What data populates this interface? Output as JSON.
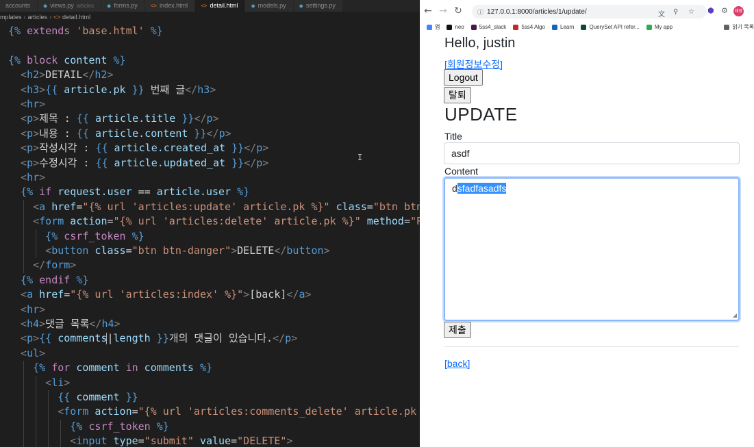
{
  "editor": {
    "tabs": [
      {
        "label": "accounts",
        "hint": "",
        "kind": "folder",
        "active": false
      },
      {
        "label": "views.py",
        "hint": "articles",
        "kind": "py",
        "active": false
      },
      {
        "label": "forms.py",
        "hint": "",
        "kind": "py",
        "active": false
      },
      {
        "label": "index.html",
        "hint": "",
        "kind": "html",
        "active": false
      },
      {
        "label": "detail.html",
        "hint": "",
        "kind": "html",
        "active": true
      },
      {
        "label": "models.py",
        "hint": "",
        "kind": "py",
        "active": false
      },
      {
        "label": "settings.py",
        "hint": "",
        "kind": "py",
        "active": false
      }
    ],
    "breadcrumb": [
      "mplates",
      "articles",
      "detail.html"
    ],
    "lines": [
      {
        "indent": 1,
        "segs": [
          [
            "tpl",
            "{% "
          ],
          [
            "kw",
            "extends "
          ],
          [
            "str",
            "'base.html'"
          ],
          [
            "tpl",
            " %}"
          ]
        ]
      },
      {
        "indent": 0,
        "segs": []
      },
      {
        "indent": 1,
        "segs": [
          [
            "tpl",
            "{% "
          ],
          [
            "kw",
            "block "
          ],
          [
            "var",
            "content"
          ],
          [
            "tpl",
            " %}"
          ]
        ]
      },
      {
        "indent": 3,
        "segs": [
          [
            "br",
            "<"
          ],
          [
            "tag",
            "h2"
          ],
          [
            "br",
            ">"
          ],
          [
            "txt",
            "DETAIL"
          ],
          [
            "br",
            "</"
          ],
          [
            "tag",
            "h2"
          ],
          [
            "br",
            ">"
          ]
        ]
      },
      {
        "indent": 3,
        "segs": [
          [
            "br",
            "<"
          ],
          [
            "tag",
            "h3"
          ],
          [
            "br",
            ">"
          ],
          [
            "tpl",
            "{{ "
          ],
          [
            "var",
            "article.pk"
          ],
          [
            "tpl",
            " }}"
          ],
          [
            "txt",
            " 번째 글"
          ],
          [
            "br",
            "</"
          ],
          [
            "tag",
            "h3"
          ],
          [
            "br",
            ">"
          ]
        ]
      },
      {
        "indent": 3,
        "segs": [
          [
            "br",
            "<"
          ],
          [
            "tag",
            "hr"
          ],
          [
            "br",
            ">"
          ]
        ]
      },
      {
        "indent": 3,
        "segs": [
          [
            "br",
            "<"
          ],
          [
            "tag",
            "p"
          ],
          [
            "br",
            ">"
          ],
          [
            "txt",
            "제목 : "
          ],
          [
            "tpl",
            "{{ "
          ],
          [
            "var",
            "article.title"
          ],
          [
            "tpl",
            " }}"
          ],
          [
            "br",
            "</"
          ],
          [
            "tag",
            "p"
          ],
          [
            "br",
            ">"
          ]
        ]
      },
      {
        "indent": 3,
        "segs": [
          [
            "br",
            "<"
          ],
          [
            "tag",
            "p"
          ],
          [
            "br",
            ">"
          ],
          [
            "txt",
            "내용 : "
          ],
          [
            "tpl",
            "{{ "
          ],
          [
            "var",
            "article.content"
          ],
          [
            "tpl",
            " }}"
          ],
          [
            "br",
            "</"
          ],
          [
            "tag",
            "p"
          ],
          [
            "br",
            ">"
          ]
        ]
      },
      {
        "indent": 3,
        "segs": [
          [
            "br",
            "<"
          ],
          [
            "tag",
            "p"
          ],
          [
            "br",
            ">"
          ],
          [
            "txt",
            "작성시각 : "
          ],
          [
            "tpl",
            "{{ "
          ],
          [
            "var",
            "article.created_at"
          ],
          [
            "tpl",
            " }}"
          ],
          [
            "br",
            "</"
          ],
          [
            "tag",
            "p"
          ],
          [
            "br",
            ">"
          ]
        ]
      },
      {
        "indent": 3,
        "segs": [
          [
            "br",
            "<"
          ],
          [
            "tag",
            "p"
          ],
          [
            "br",
            ">"
          ],
          [
            "txt",
            "수정시각 : "
          ],
          [
            "tpl",
            "{{ "
          ],
          [
            "var",
            "article.updated_at"
          ],
          [
            "tpl",
            " }}"
          ],
          [
            "br",
            "</"
          ],
          [
            "tag",
            "p"
          ],
          [
            "br",
            ">"
          ]
        ]
      },
      {
        "indent": 3,
        "segs": [
          [
            "br",
            "<"
          ],
          [
            "tag",
            "hr"
          ],
          [
            "br",
            ">"
          ]
        ]
      },
      {
        "indent": 3,
        "segs": [
          [
            "tpl",
            "{% "
          ],
          [
            "kw",
            "if "
          ],
          [
            "var",
            "request.user"
          ],
          [
            "txt",
            " == "
          ],
          [
            "var",
            "article.user"
          ],
          [
            "tpl",
            " %}"
          ]
        ]
      },
      {
        "indent": 5,
        "segs": [
          [
            "br",
            "<"
          ],
          [
            "tag",
            "a"
          ],
          [
            "attr",
            " href"
          ],
          [
            "txt",
            "="
          ],
          [
            "str",
            "\"{% url 'articles:update' article.pk %}\""
          ],
          [
            "attr",
            " class"
          ],
          [
            "txt",
            "="
          ],
          [
            "str",
            "\"btn btn-p"
          ]
        ]
      },
      {
        "indent": 5,
        "segs": [
          [
            "br",
            "<"
          ],
          [
            "tag",
            "form"
          ],
          [
            "attr",
            " action"
          ],
          [
            "txt",
            "="
          ],
          [
            "str",
            "\"{% url 'articles:delete' article.pk %}\""
          ],
          [
            "attr",
            " method"
          ],
          [
            "txt",
            "="
          ],
          [
            "str",
            "\"POS"
          ]
        ]
      },
      {
        "indent": 7,
        "segs": [
          [
            "tpl",
            "{% "
          ],
          [
            "kw",
            "csrf_token"
          ],
          [
            "tpl",
            " %}"
          ]
        ]
      },
      {
        "indent": 7,
        "segs": [
          [
            "br",
            "<"
          ],
          [
            "tag",
            "button"
          ],
          [
            "attr",
            " class"
          ],
          [
            "txt",
            "="
          ],
          [
            "str",
            "\"btn btn-danger\""
          ],
          [
            "br",
            ">"
          ],
          [
            "txt",
            "DELETE"
          ],
          [
            "br",
            "</"
          ],
          [
            "tag",
            "button"
          ],
          [
            "br",
            ">"
          ]
        ]
      },
      {
        "indent": 5,
        "segs": [
          [
            "br",
            "</"
          ],
          [
            "tag",
            "form"
          ],
          [
            "br",
            ">"
          ]
        ]
      },
      {
        "indent": 3,
        "segs": [
          [
            "tpl",
            "{% "
          ],
          [
            "kw",
            "endif"
          ],
          [
            "tpl",
            " %}"
          ]
        ]
      },
      {
        "indent": 3,
        "segs": [
          [
            "br",
            "<"
          ],
          [
            "tag",
            "a"
          ],
          [
            "attr",
            " href"
          ],
          [
            "txt",
            "="
          ],
          [
            "str",
            "\"{% url 'articles:index' %}\""
          ],
          [
            "br",
            ">"
          ],
          [
            "txt",
            "[back]"
          ],
          [
            "br",
            "</"
          ],
          [
            "tag",
            "a"
          ],
          [
            "br",
            ">"
          ]
        ]
      },
      {
        "indent": 3,
        "segs": [
          [
            "br",
            "<"
          ],
          [
            "tag",
            "hr"
          ],
          [
            "br",
            ">"
          ]
        ]
      },
      {
        "indent": 3,
        "segs": [
          [
            "br",
            "<"
          ],
          [
            "tag",
            "h4"
          ],
          [
            "br",
            ">"
          ],
          [
            "txt",
            "댓글 목록"
          ],
          [
            "br",
            "</"
          ],
          [
            "tag",
            "h4"
          ],
          [
            "br",
            ">"
          ]
        ]
      },
      {
        "indent": 3,
        "segs": [
          [
            "br",
            "<"
          ],
          [
            "tag",
            "p"
          ],
          [
            "br",
            ">"
          ],
          [
            "tpl",
            "{{ "
          ],
          [
            "var",
            "comments"
          ],
          [
            "txt",
            "|"
          ],
          [
            "var",
            "length"
          ],
          [
            "tpl",
            " }}"
          ],
          [
            "txt",
            "개의 댓글이 있습니다."
          ],
          [
            "br",
            "</"
          ],
          [
            "tag",
            "p"
          ],
          [
            "br",
            ">"
          ]
        ]
      },
      {
        "indent": 3,
        "segs": [
          [
            "br",
            "<"
          ],
          [
            "tag",
            "ul"
          ],
          [
            "br",
            ">"
          ]
        ]
      },
      {
        "indent": 5,
        "segs": [
          [
            "tpl",
            "{% "
          ],
          [
            "kw",
            "for "
          ],
          [
            "var",
            "comment"
          ],
          [
            "kw",
            " in "
          ],
          [
            "var",
            "comments"
          ],
          [
            "tpl",
            " %}"
          ]
        ]
      },
      {
        "indent": 7,
        "segs": [
          [
            "br",
            "<"
          ],
          [
            "tag",
            "li"
          ],
          [
            "br",
            ">"
          ]
        ]
      },
      {
        "indent": 9,
        "segs": [
          [
            "tpl",
            "{{ "
          ],
          [
            "var",
            "comment"
          ],
          [
            "tpl",
            " }}"
          ]
        ]
      },
      {
        "indent": 9,
        "segs": [
          [
            "br",
            "<"
          ],
          [
            "tag",
            "form"
          ],
          [
            "attr",
            " action"
          ],
          [
            "txt",
            "="
          ],
          [
            "str",
            "\"{% url 'articles:comments_delete' article.pk co"
          ]
        ]
      },
      {
        "indent": 11,
        "segs": [
          [
            "tpl",
            "{% "
          ],
          [
            "kw",
            "csrf_token"
          ],
          [
            "tpl",
            " %}"
          ]
        ]
      },
      {
        "indent": 11,
        "segs": [
          [
            "br",
            "<"
          ],
          [
            "tag",
            "input"
          ],
          [
            "attr",
            " type"
          ],
          [
            "txt",
            "="
          ],
          [
            "str",
            "\"submit\""
          ],
          [
            "attr",
            " value"
          ],
          [
            "txt",
            "="
          ],
          [
            "str",
            "\"DELETE\""
          ],
          [
            "br",
            ">"
          ]
        ]
      }
    ],
    "colors": {
      "background": "#1e1e1e",
      "template": "#569cd6",
      "keyword": "#c586c0",
      "string": "#ce9178",
      "variable": "#9cdcfe",
      "text": "#d4d4d4"
    }
  },
  "browser": {
    "url": "127.0.0.1:8000/articles/1/update/",
    "nav_icons": [
      "back-arrow-icon",
      "forward-arrow-icon",
      "reload-icon"
    ],
    "profile_initials": "태영",
    "bookmarks": [
      {
        "label": "앱",
        "color": "#4285f4"
      },
      {
        "label": "neo",
        "color": "#111111"
      },
      {
        "label": "5ss4_slack",
        "color": "#4a154b"
      },
      {
        "label": "5ss4 Algo",
        "color": "#c62828"
      },
      {
        "label": "Learn",
        "color": "#1565c0"
      },
      {
        "label": "QuerySet API refer...",
        "color": "#0c4b33"
      },
      {
        "label": "My app",
        "color": "#34a853"
      },
      {
        "label": "읽기 목록",
        "color": "#5f6368"
      }
    ]
  },
  "page": {
    "greeting": "Hello, justin",
    "profile_link": "[회원정보수정]",
    "logout_label": "Logout",
    "withdraw_label": "탈퇴",
    "title": "UPDATE",
    "title_label": "Title",
    "title_value": "asdf",
    "content_label": "Content",
    "content_prefix": "d",
    "content_selected": "sfadfasadfs",
    "submit_label": "제출",
    "back_link": "[back]",
    "accent": "#0d6efd"
  }
}
